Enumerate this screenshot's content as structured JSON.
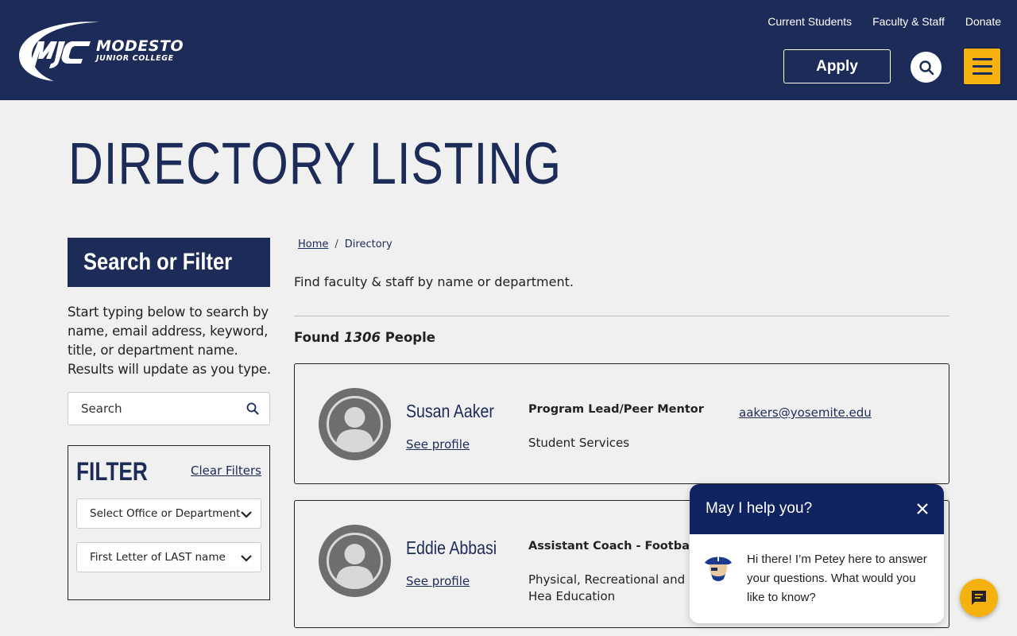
{
  "header": {
    "logo": {
      "line1": "MODESTO",
      "line2": "JUNIOR COLLEGE"
    },
    "top_links": [
      "Current Students",
      "Faculty & Staff",
      "Donate"
    ],
    "apply_label": "Apply",
    "search_icon": "search-icon",
    "menu_icon": "hamburger-menu-icon",
    "colors": {
      "navy": "#1c2b57",
      "gold": "#f5b20f"
    }
  },
  "page": {
    "title": "DIRECTORY LISTING"
  },
  "sidebar": {
    "heading": "Search or Filter",
    "description": "Start typing below to search by name, email address, keyword, title, or department name. Results will update as you type.",
    "search_placeholder": "Search",
    "filter": {
      "title": "FILTER",
      "clear_label": "Clear Filters",
      "department_select": "Select Office or Department",
      "letter_select": "First Letter of LAST name"
    }
  },
  "main": {
    "breadcrumb": {
      "home": "Home",
      "separator": "/",
      "current": "Directory"
    },
    "intro": "Find faculty & staff by name or department.",
    "found": {
      "prefix": "Found",
      "count": "1306",
      "suffix": "People"
    },
    "people": [
      {
        "name": "Susan Aaker",
        "link": "See profile",
        "title": "Program Lead/Peer Mentor",
        "department": "Student Services",
        "email": "aakers@yosemite.edu"
      },
      {
        "name": "Eddie Abbasi",
        "link": "See profile",
        "title": "Assistant Coach - Football",
        "department": "Physical, Recreational and Hea Education",
        "email": ""
      }
    ]
  },
  "chat": {
    "title": "May I help you?",
    "message": "Hi there! I’m Petey here to answer your questions. What would you like to know?",
    "close_icon": "close-icon",
    "fab_icon": "chat-bubble-icon"
  }
}
